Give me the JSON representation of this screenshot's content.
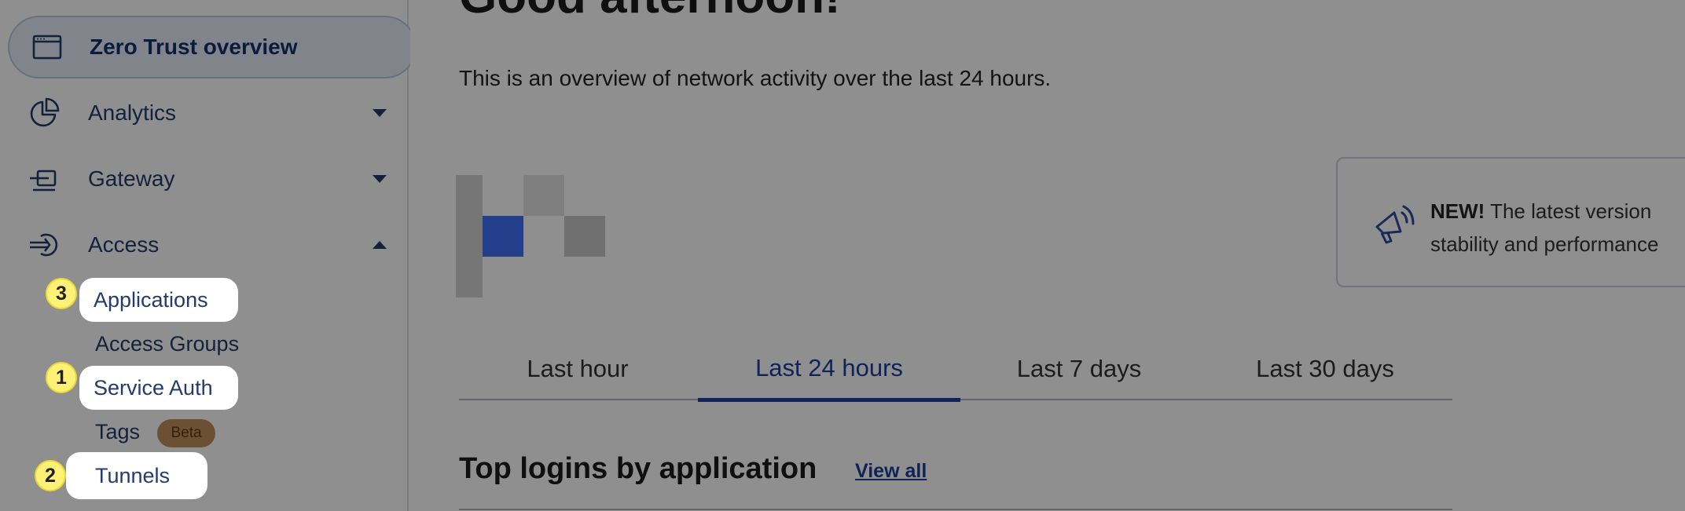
{
  "sidebar": {
    "items": [
      {
        "label": "Zero Trust overview",
        "icon": "browser-window-icon",
        "active": true
      },
      {
        "label": "Analytics",
        "icon": "pie-chart-icon",
        "expanded": false
      },
      {
        "label": "Gateway",
        "icon": "gateway-icon",
        "expanded": false
      },
      {
        "label": "Access",
        "icon": "access-icon",
        "expanded": true
      }
    ],
    "access_sub": {
      "applications": "Applications",
      "access_groups": "Access Groups",
      "service_auth": "Service Auth",
      "tags": "Tags",
      "tags_badge": "Beta",
      "tunnels": "Tunnels"
    },
    "step_badges": {
      "applications": "3",
      "service_auth": "1",
      "tunnels": "2"
    }
  },
  "main": {
    "greeting": "Good afternoon!",
    "subtitle": "This is an overview of network activity over the last 24 hours.",
    "notice": {
      "strong": "NEW!",
      "line1": " The latest version",
      "line2": "stability and performance"
    },
    "tabs": [
      "Last hour",
      "Last 24 hours",
      "Last 7 days",
      "Last 30 days"
    ],
    "active_tab": "Last 24 hours",
    "section_title": "Top logins by application",
    "view_all": "View all"
  },
  "colors": {
    "accent": "#1c3f9e",
    "sidebar_text": "#243b6b",
    "badge_yellow": "#fff078",
    "beta_badge": "#c08f5e"
  }
}
